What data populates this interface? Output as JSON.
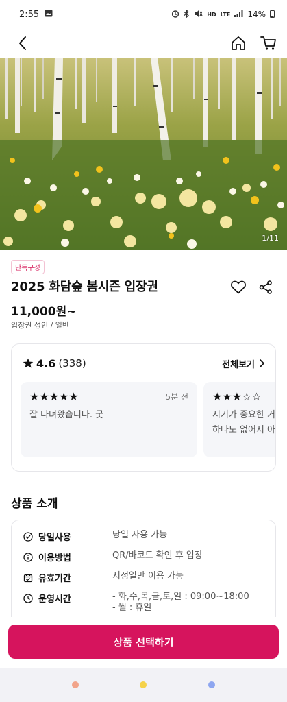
{
  "status_bar": {
    "time": "2:55",
    "battery": "14%",
    "network": "LTE"
  },
  "hero": {
    "counter": "1/11"
  },
  "product": {
    "badge": "단독구성",
    "title": "2025 화담숲 봄시즌 입장권",
    "price": "11,000원~",
    "price_sub": "입장권 성인 / 일반"
  },
  "reviews": {
    "score": "4.6",
    "count": "(338)",
    "see_all": "전체보기",
    "items": [
      {
        "stars": "★★★★★",
        "time": "5분 전",
        "text": "잘 다녀왔습니다. 굿"
      },
      {
        "stars": "★★★☆☆",
        "time": "",
        "text_line1": "시기가 중요한 거",
        "text_line2": "하나도 없어서 아"
      }
    ]
  },
  "intro": {
    "section_title": "상품 소개",
    "rows": [
      {
        "label": "당일사용",
        "value": "당일 사용 가능",
        "icon": "check-circle-icon"
      },
      {
        "label": "이용방법",
        "value": "QR/바코드 확인 후 입장",
        "icon": "info-icon"
      },
      {
        "label": "유효기간",
        "value": "지정일만 이용 가능",
        "icon": "calendar-icon"
      },
      {
        "label": "운영시간",
        "value_line1": "- 화,수,목,금,토,일 : 09:00~18:00",
        "value_line2": "- 월 : 휴일",
        "icon": "clock-icon"
      }
    ]
  },
  "cta": {
    "label": "상품 선택하기"
  },
  "colors": {
    "accent": "#d6145d",
    "badge_text": "#d61d5c",
    "nav_dot_1": "#f2a48a",
    "nav_dot_2": "#f5d24a",
    "nav_dot_3": "#8ea6f0"
  }
}
